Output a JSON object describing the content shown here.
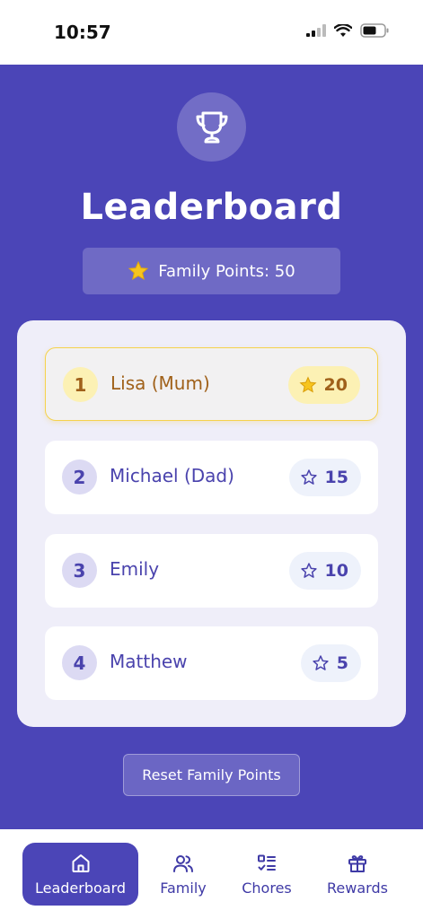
{
  "status_bar": {
    "time": "10:57"
  },
  "header": {
    "title": "Leaderboard",
    "family_points_label": "Family Points: 50"
  },
  "leaderboard": {
    "members": [
      {
        "rank": "1",
        "name": "Lisa (Mum)",
        "points": "20",
        "leader": true
      },
      {
        "rank": "2",
        "name": "Michael (Dad)",
        "points": "15",
        "leader": false
      },
      {
        "rank": "3",
        "name": "Emily",
        "points": "10",
        "leader": false
      },
      {
        "rank": "4",
        "name": "Matthew",
        "points": "5",
        "leader": false
      }
    ]
  },
  "actions": {
    "reset_label": "Reset Family Points"
  },
  "tabs": [
    {
      "label": "Leaderboard",
      "icon": "home-icon",
      "active": true
    },
    {
      "label": "Family",
      "icon": "users-icon",
      "active": false
    },
    {
      "label": "Chores",
      "icon": "checklist-icon",
      "active": false
    },
    {
      "label": "Rewards",
      "icon": "gift-icon",
      "active": false
    }
  ],
  "colors": {
    "primary": "#4b45b7",
    "leader_accent": "#f5d24c",
    "leader_text": "#a0611a",
    "member_text": "#4a43ad"
  }
}
